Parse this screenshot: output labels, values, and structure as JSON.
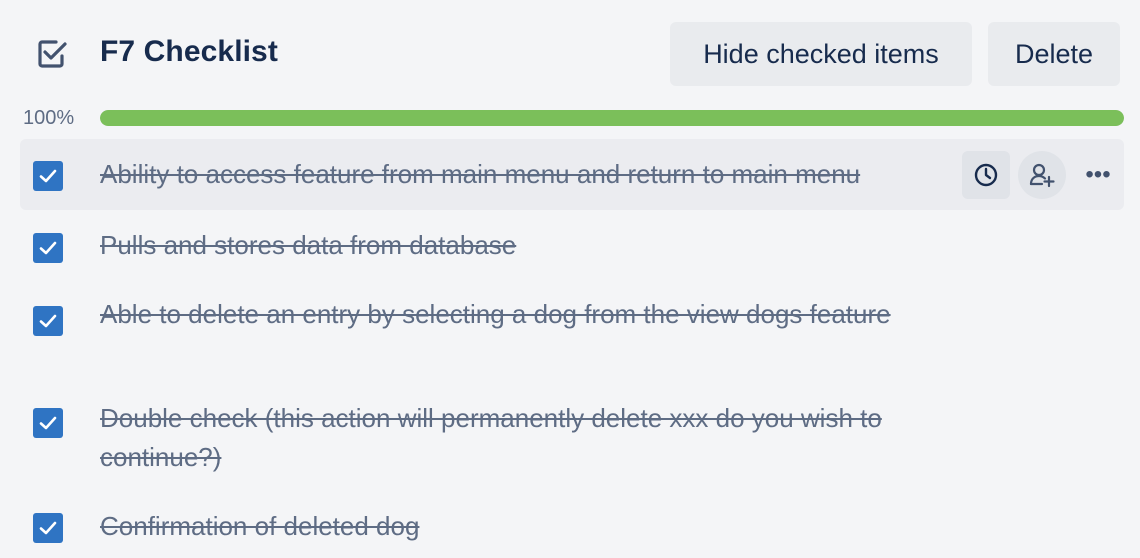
{
  "checklist": {
    "icon": "checklist-icon",
    "title": "F7 Checklist",
    "hide_checked_label": "Hide checked items",
    "delete_label": "Delete",
    "progress_percent": 100,
    "progress_label": "100%"
  },
  "items": [
    {
      "text": "Ability to access feature from main menu and return to main menu",
      "checked": true,
      "hovered": true
    },
    {
      "text": "Pulls and stores data from database",
      "checked": true
    },
    {
      "text": "Able to delete an entry by selecting a dog from the view dogs feature",
      "checked": true
    },
    {
      "text": "Double check (this action will permanently delete xxx do you wish to continue?)",
      "checked": true
    },
    {
      "text": "Confirmation of deleted dog",
      "checked": true
    }
  ],
  "item_actions": {
    "due_date_icon": "clock-icon",
    "assign_icon": "add-member-icon",
    "more_icon": "more-options-icon",
    "more_glyph": "•••"
  },
  "colors": {
    "progress": "#7bbf5a",
    "checkbox": "#2f74c3",
    "title": "#172b4d",
    "muted": "#5e6c84"
  }
}
